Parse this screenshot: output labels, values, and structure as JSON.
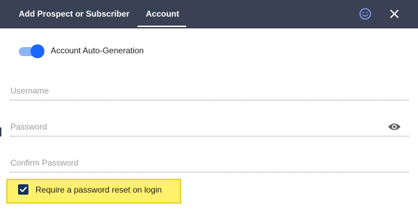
{
  "header": {
    "tabs": [
      {
        "label": "Add Prospect or Subscriber"
      },
      {
        "label": "Account"
      }
    ],
    "active_tab": "Account",
    "icons": [
      "smiley-icon",
      "close-icon"
    ]
  },
  "auto_generation": {
    "label": "Account Auto-Generation",
    "enabled": true
  },
  "fields": {
    "username": {
      "placeholder": "Username",
      "value": ""
    },
    "password": {
      "placeholder": "Password",
      "value": ""
    },
    "confirm_password": {
      "placeholder": "Confirm Password",
      "value": ""
    }
  },
  "password_reset": {
    "label": "Require a password reset on login",
    "checked": true
  },
  "colors": {
    "header_bg": "#3a4154",
    "toggle_active": "#1a66ff",
    "toggle_track": "#8cb4f5",
    "checkbox": "#15305a",
    "highlight": "#fff16c"
  }
}
